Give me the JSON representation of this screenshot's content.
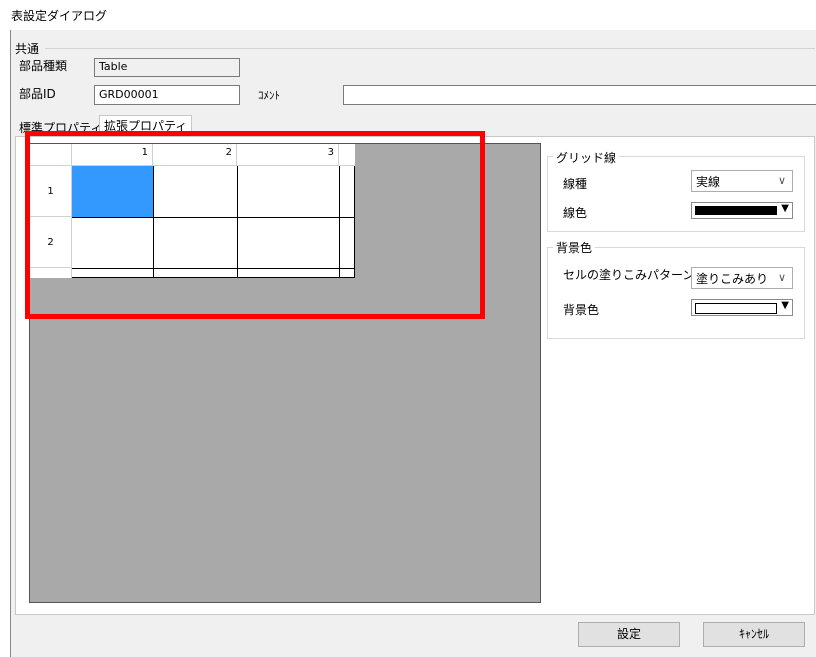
{
  "window": {
    "title": "表設定ダイアログ"
  },
  "common": {
    "group_title": "共通",
    "part_type_label": "部品種類",
    "part_type_value": "Table",
    "part_id_label": "部品ID",
    "part_id_value": "GRD00001",
    "comment_label": "ｺﾒﾝﾄ",
    "comment_value": ""
  },
  "tabs": [
    {
      "label": "標準プロパティ",
      "selected": false
    },
    {
      "label": "拡張プロパティ",
      "selected": true
    }
  ],
  "preview": {
    "column_headers": [
      "1",
      "2",
      "3"
    ],
    "row_headers": [
      "1",
      "2"
    ],
    "selected_cell_color": "#3399ff",
    "highlight_color": "#ff0000",
    "background_color": "#a9a9a9"
  },
  "grid_line": {
    "group_title": "グリッド線",
    "line_type_label": "線種",
    "line_type_value": "実線",
    "line_color_label": "線色",
    "line_color": "#000000"
  },
  "background": {
    "group_title": "背景色",
    "fill_pattern_label": "セルの塗りこみパターン",
    "fill_pattern_value": "塗りこみあり",
    "bg_color_label": "背景色",
    "bg_color": "#ffffff"
  },
  "buttons": {
    "ok_label": "設定",
    "cancel_label": "ｷｬﾝｾﾙ"
  }
}
